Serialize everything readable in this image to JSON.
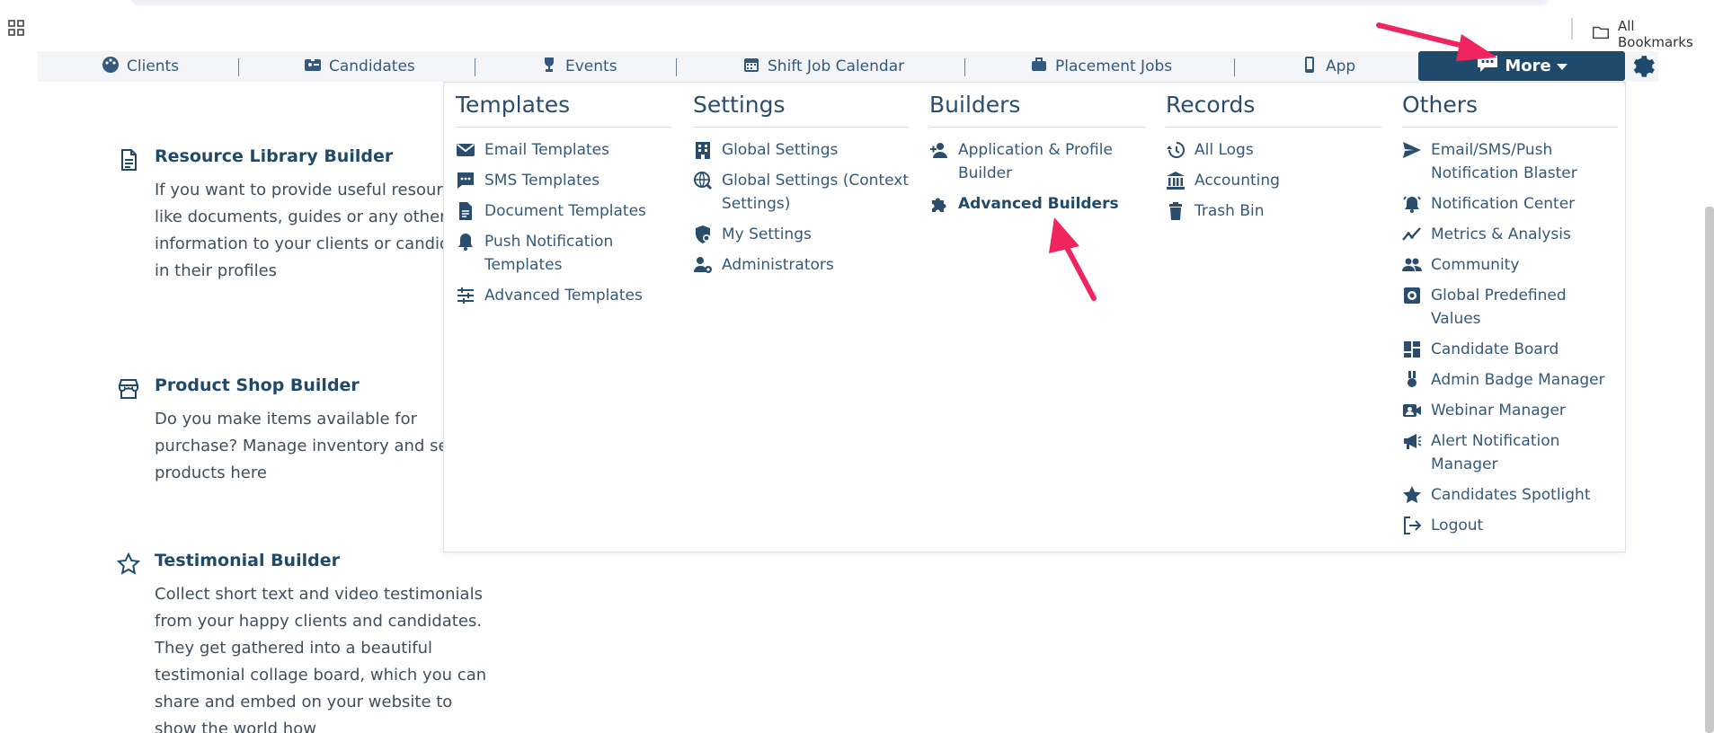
{
  "browser": {
    "bookmarks_label": "All Bookmarks"
  },
  "nav": {
    "items": [
      {
        "label": "Clients",
        "icon": "palette-icon"
      },
      {
        "label": "Candidates",
        "icon": "id-card-icon"
      },
      {
        "label": "Events",
        "icon": "trophy-icon"
      },
      {
        "label": "Shift Job Calendar",
        "icon": "calendar-icon"
      },
      {
        "label": "Placement Jobs",
        "icon": "briefcase-icon"
      },
      {
        "label": "App",
        "icon": "phone-icon"
      }
    ],
    "more_label": "More",
    "settings_icon": "gear-icon"
  },
  "cards": [
    {
      "title": "Resource Library Builder",
      "desc": "If you want to provide useful resources like documents, guides or any other information to your clients or candidates in their profiles",
      "icon": "document-icon"
    },
    {
      "title": "Product Shop Builder",
      "desc": "Do you make items available for purchase? Manage inventory and sell products here",
      "icon": "store-icon"
    },
    {
      "title": "Testimonial Builder",
      "desc": "Collect short text and video testimonials from your happy clients and candidates. They get gathered into a beautiful testimonial collage board, which you can share and embed on your website to show the world how",
      "icon": "star-icon"
    }
  ],
  "menu": {
    "columns": [
      {
        "title": "Templates",
        "items": [
          "Email Templates",
          "SMS Templates",
          "Document Templates",
          "Push Notification Templates",
          "Advanced Templates"
        ]
      },
      {
        "title": "Settings",
        "items": [
          "Global Settings",
          "Global Settings (Context Settings)",
          "My Settings",
          "Administrators"
        ]
      },
      {
        "title": "Builders",
        "items": [
          "Application & Profile Builder",
          "Advanced Builders"
        ]
      },
      {
        "title": "Records",
        "items": [
          "All Logs",
          "Accounting",
          "Trash Bin"
        ]
      },
      {
        "title": "Others",
        "items": [
          "Email/SMS/Push Notification Blaster",
          "Notification Center",
          "Metrics & Analysis",
          "Community",
          "Global Predefined Values",
          "Candidate Board",
          "Admin Badge Manager",
          "Webinar Manager",
          "Alert Notification Manager",
          "Candidates Spotlight",
          "Logout"
        ]
      }
    ]
  },
  "colors": {
    "primary": "#1f4a6c",
    "link": "#34597c",
    "annotation_arrow": "#f0245e"
  }
}
